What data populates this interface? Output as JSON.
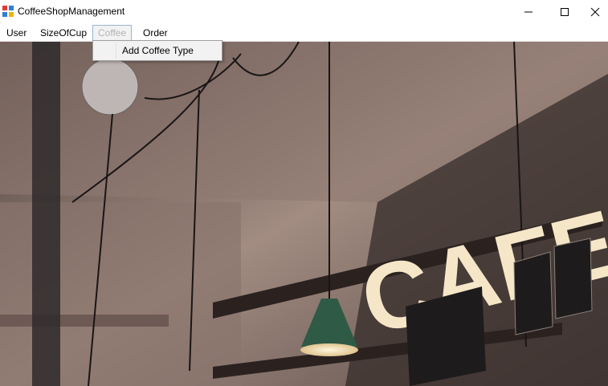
{
  "window": {
    "title": "CoffeeShopManagement",
    "minimize_glyph": "—",
    "maximize_glyph": "☐",
    "close_glyph": "✕"
  },
  "menubar": {
    "items": [
      {
        "label": "User"
      },
      {
        "label": "SizeOfCup"
      },
      {
        "label": "Coffee"
      },
      {
        "label": "Order"
      }
    ]
  },
  "dropdown": {
    "items": [
      {
        "label": "Add Coffee Type"
      }
    ]
  },
  "background": {
    "sign_text": "CAFE"
  },
  "colors": {
    "menu_open_border": "#99b4d1",
    "menu_disabled_text": "#b3b3b3",
    "bulb_glow": "#f5e6c8"
  }
}
